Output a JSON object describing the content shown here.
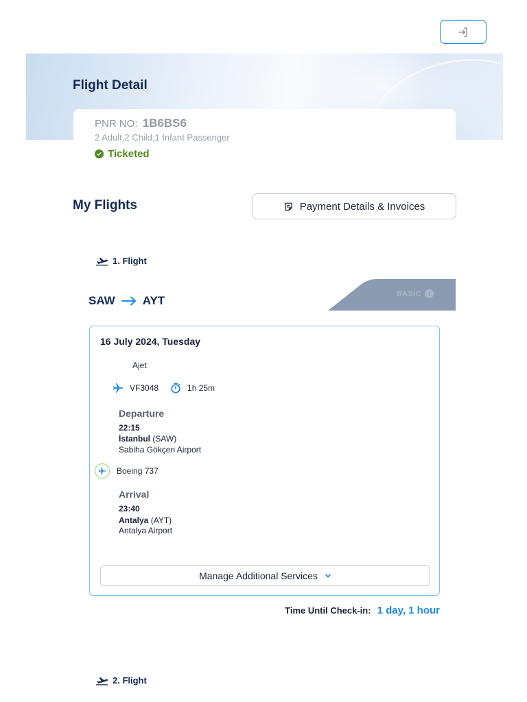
{
  "header": {
    "login_icon": "sign-in-icon"
  },
  "hero": {
    "title": "Flight Detail"
  },
  "booking": {
    "pnr_label": "PNR NO:",
    "pnr_value": "1B6BS6",
    "passengers": "2 Adult,2 Child,1 Infant Passenger",
    "status": "Ticketed",
    "status_color": "#4f8a1f"
  },
  "my_flights": {
    "title": "My Flights",
    "payment_button": "Payment Details & Invoices"
  },
  "flights": [
    {
      "heading": "1. Flight",
      "origin": "SAW",
      "destination": "AYT",
      "fare": "BASIC",
      "date": "16 July 2024, Tuesday",
      "carrier": "Ajet",
      "flight_number": "VF3048",
      "duration": "1h 25m",
      "departure": {
        "label": "Departure",
        "time": "22:15",
        "city": "İstanbul",
        "code": "(SAW)",
        "airport": "Sabiha Gökçen Airport"
      },
      "aircraft": "Boeing 737",
      "arrival": {
        "label": "Arrival",
        "time": "23:40",
        "city": "Antalya",
        "code": "(AYT)",
        "airport": "Antalya Airport"
      },
      "manage_button": "Manage Additional Services",
      "checkin_label": "Time Until Check-in:",
      "checkin_value": "1 day, 1 hour"
    },
    {
      "heading": "2. Flight"
    }
  ],
  "colors": {
    "accent": "#1c8be0",
    "title": "#142a55",
    "card_border": "#7fc0f0",
    "fare_tag": "#8b9bb1"
  }
}
